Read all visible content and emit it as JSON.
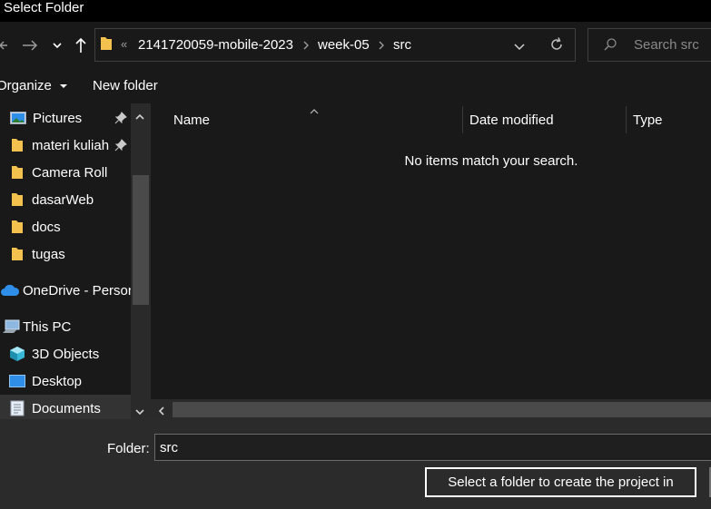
{
  "window": {
    "title": "Select Folder"
  },
  "address_bar": {
    "overflow": "«",
    "breadcrumbs": [
      "2141720059-mobile-2023",
      "week-05",
      "src"
    ]
  },
  "search": {
    "placeholder": "Search src"
  },
  "toolbar": {
    "organize_label": "Organize",
    "new_folder_label": "New folder"
  },
  "sidebar": {
    "items": [
      {
        "label": "Pictures",
        "icon": "pictures-icon",
        "pinned": true
      },
      {
        "label": "materi kuliah",
        "icon": "folder-icon",
        "pinned": true
      },
      {
        "label": "Camera Roll",
        "icon": "folder-icon"
      },
      {
        "label": "dasarWeb",
        "icon": "folder-icon"
      },
      {
        "label": "docs",
        "icon": "folder-icon"
      },
      {
        "label": "tugas",
        "icon": "folder-icon"
      },
      {
        "label": "OneDrive - Person",
        "icon": "onedrive-icon"
      },
      {
        "label": "This PC",
        "icon": "this-pc-icon"
      },
      {
        "label": "3D Objects",
        "icon": "3d-objects-icon"
      },
      {
        "label": "Desktop",
        "icon": "desktop-icon"
      },
      {
        "label": "Documents",
        "icon": "documents-icon",
        "selected": true
      }
    ]
  },
  "file_list": {
    "columns": [
      "Name",
      "Date modified",
      "Type"
    ],
    "empty_message": "No items match your search."
  },
  "footer": {
    "folder_label": "Folder:",
    "folder_value": "src",
    "select_button_label": "Select a folder to create the project in"
  },
  "colors": {
    "background": "#202020",
    "pane": "#191919",
    "footer": "#2b2b2b",
    "folder_yellow": "#f2c14e",
    "onedrive_blue": "#2f8ee8"
  }
}
